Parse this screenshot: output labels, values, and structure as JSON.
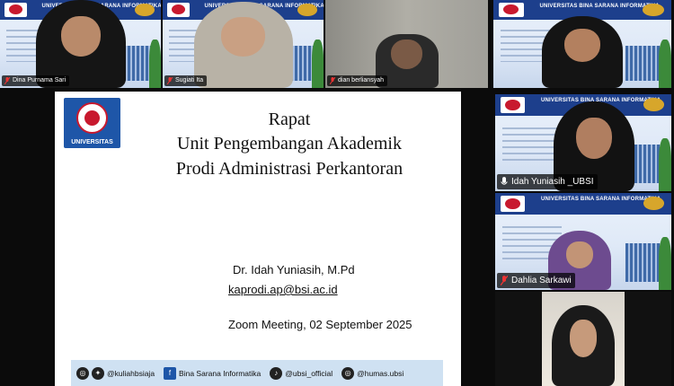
{
  "meeting": {
    "participants_top": [
      {
        "name": "Dina Purnama Sari"
      },
      {
        "name": "Sugiati Ita"
      },
      {
        "name": "dian berliansyah"
      },
      {
        "name": ""
      }
    ],
    "participants_side": [
      {
        "name": "Idah Yuniasih _UBSI",
        "active": true
      },
      {
        "name": "Dahlia Sarkawi",
        "active": false
      },
      {
        "name": "",
        "active": false
      }
    ],
    "background_banner_text": "UNIVERSITAS BINA SARANA INFORMATIKA"
  },
  "slide": {
    "logo_text": "UNIVERSITAS",
    "title_line1": "Rapat",
    "title_line2": "Unit Pengembangan Akademik",
    "title_line3": "Prodi Administrasi Perkantoran",
    "speaker": "Dr. Idah Yuniasih, M.Pd",
    "email": "kaprodi.ap@bsi.ac.id",
    "meeting_info": "Zoom Meeting, 02 September 2025",
    "footer": {
      "social1": "@kuliahbsiaja",
      "social2": "Bina Sarana Informatika",
      "social3": "@ubsi_official",
      "social4": "@humas.ubsi"
    }
  },
  "colors": {
    "active_speaker": "#2ee07a",
    "brand_blue": "#1e56a8",
    "brand_red": "#c8192e"
  }
}
